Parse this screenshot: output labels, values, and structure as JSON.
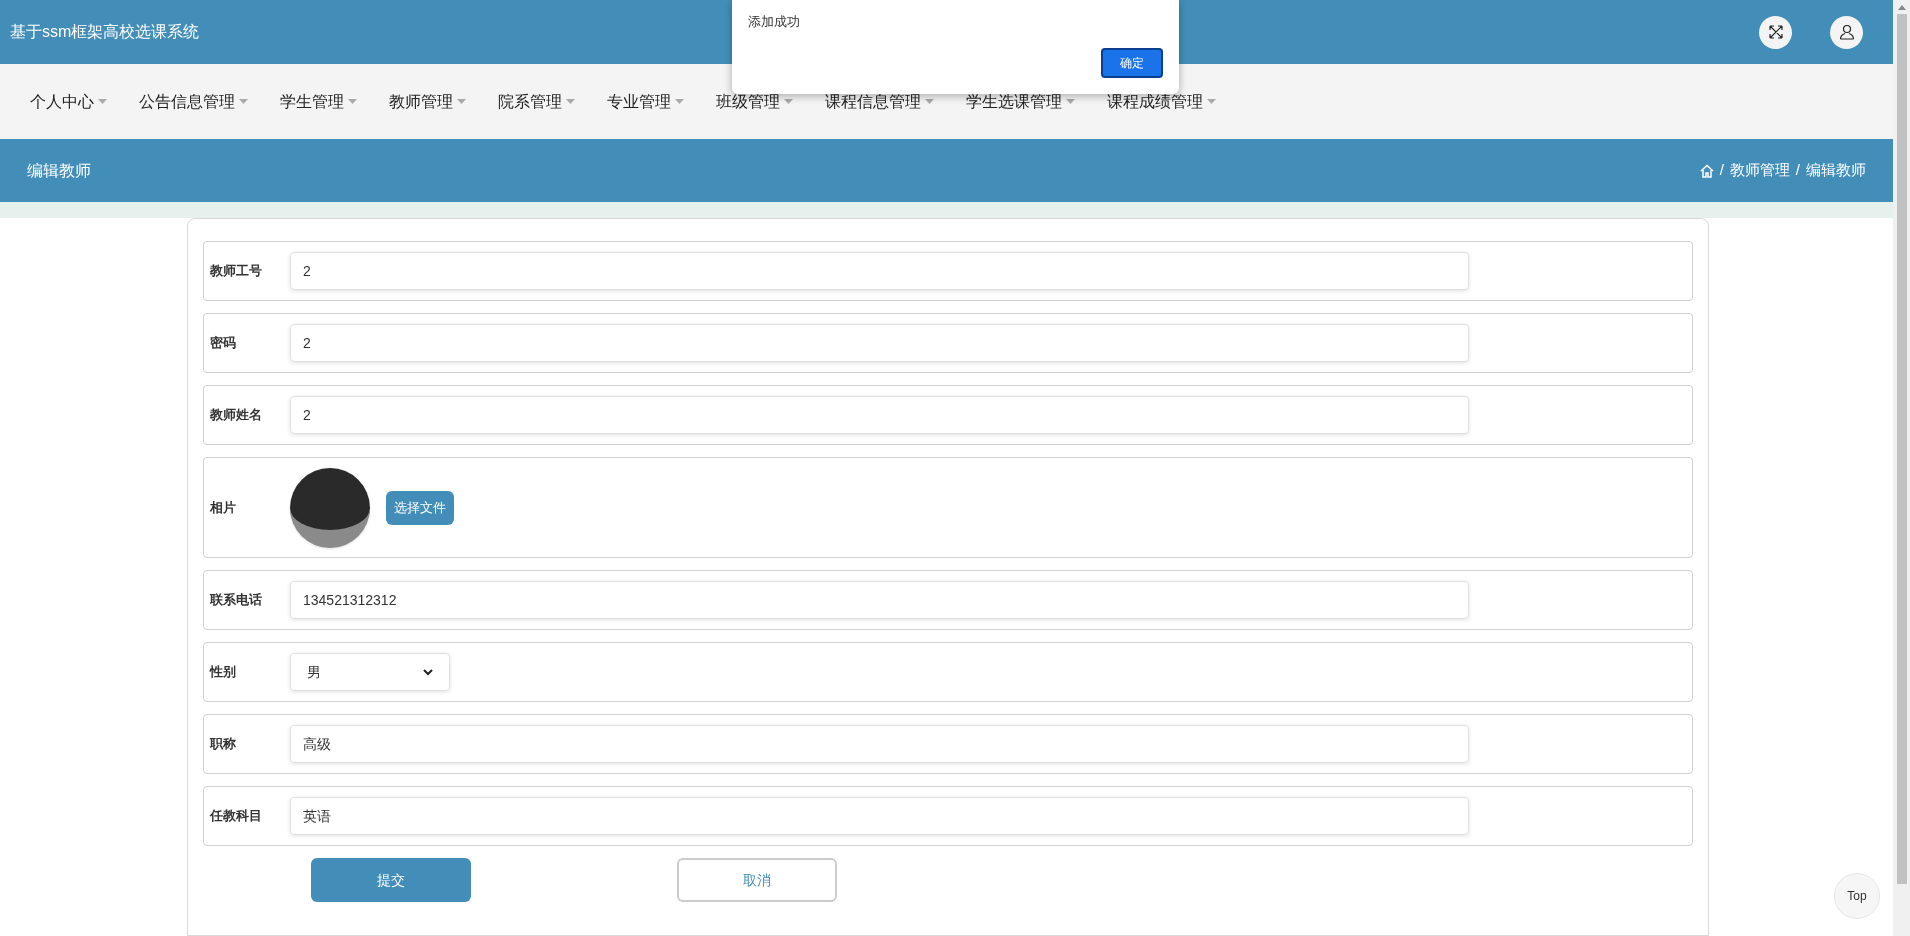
{
  "header": {
    "title": "基于ssm框架高校选课系统"
  },
  "nav": [
    {
      "label": "个人中心"
    },
    {
      "label": "公告信息管理"
    },
    {
      "label": "学生管理"
    },
    {
      "label": "教师管理"
    },
    {
      "label": "院系管理"
    },
    {
      "label": "专业管理"
    },
    {
      "label": "班级管理"
    },
    {
      "label": "课程信息管理"
    },
    {
      "label": "学生选课管理"
    },
    {
      "label": "课程成绩管理"
    }
  ],
  "dialog": {
    "message": "添加成功",
    "button": "确定"
  },
  "page_title": "编辑教师",
  "breadcrumb": [
    {
      "separator": "/",
      "label": "教师管理"
    },
    {
      "separator": "/",
      "label": "编辑教师"
    }
  ],
  "form": [
    {
      "kind": "text",
      "label": "教师工号",
      "value": "2"
    },
    {
      "kind": "text",
      "label": "密码",
      "value": "2"
    },
    {
      "kind": "text",
      "label": "教师姓名",
      "value": "2"
    },
    {
      "kind": "photo",
      "label": "相片",
      "button": "选择文件"
    },
    {
      "kind": "text",
      "label": "联系电话",
      "value": "134521312312"
    },
    {
      "kind": "select",
      "label": "性别",
      "value": "男"
    },
    {
      "kind": "text",
      "label": "职称",
      "value": "高级"
    },
    {
      "kind": "text",
      "label": "任教科目",
      "value": "英语"
    }
  ],
  "actions": [
    {
      "kind": "primary",
      "label": "提交"
    },
    {
      "kind": "outline",
      "label": "取消"
    }
  ],
  "top_button": "Top"
}
